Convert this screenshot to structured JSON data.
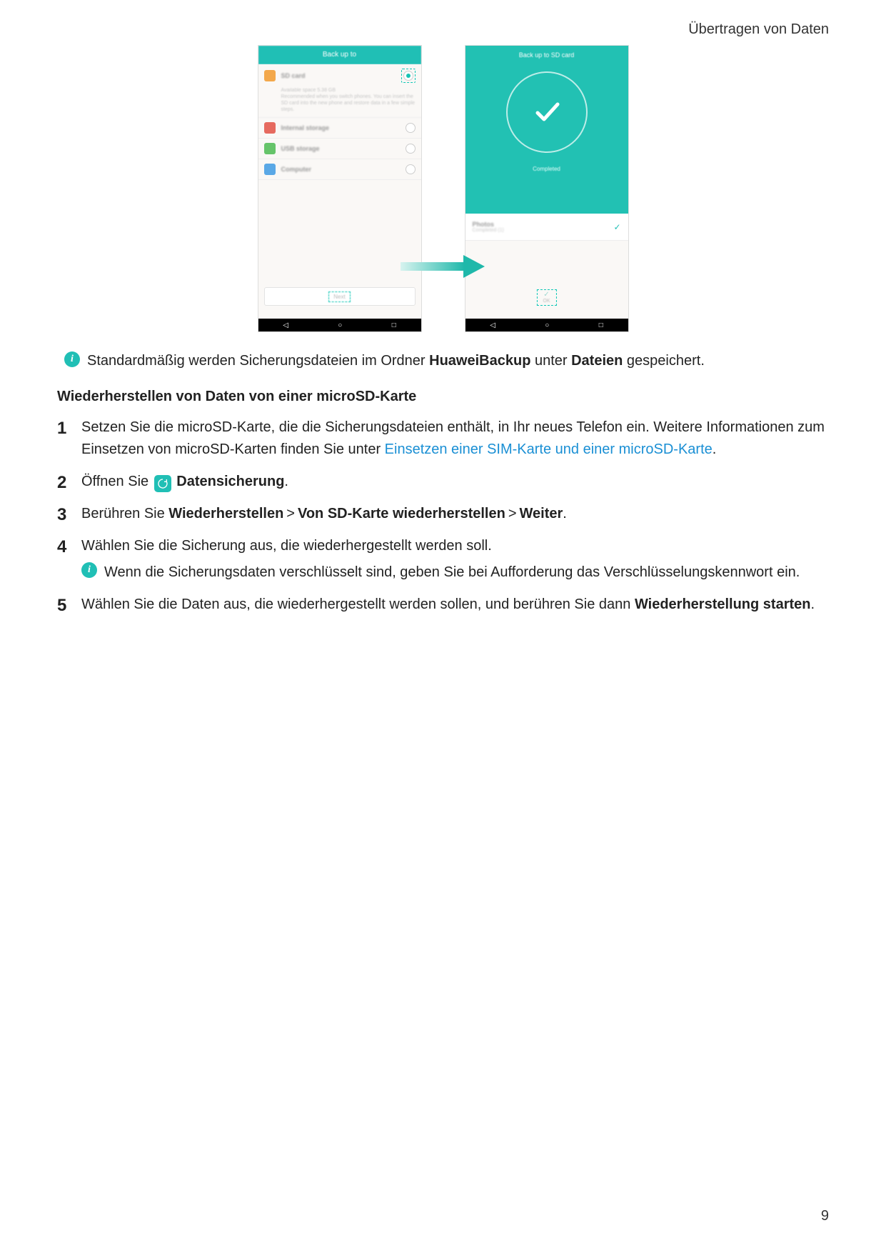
{
  "header": {
    "title": "Übertragen von Daten"
  },
  "page_number": "9",
  "phone1": {
    "title": "Back up to",
    "opt_sd": "SD card",
    "desc1": "Available space 5.38 GB",
    "desc2": "Recommended when you switch phones. You can insert the SD card into the new phone and restore data in a few simple steps.",
    "opt_internal": "Internal storage",
    "opt_usb": "USB storage",
    "opt_computer": "Computer",
    "next": "Next"
  },
  "phone2": {
    "title": "Back up to SD card",
    "completed": "Completed",
    "photos": "Photos",
    "photos_sub": "Completed (1)",
    "ok": "OK"
  },
  "info1": {
    "pre": "Standardmäßig werden Sicherungsdateien im Ordner ",
    "bold1": "HuaweiBackup",
    "mid": " unter ",
    "bold2": "Dateien",
    "post": " gespeichert."
  },
  "section_title": "Wiederherstellen von Daten von einer microSD-Karte",
  "steps": {
    "s1a": "Setzen Sie die microSD-Karte, die die Sicherungsdateien enthält, in Ihr neues Telefon ein. Weitere Informationen zum Einsetzen von microSD-Karten finden Sie unter ",
    "s1link": "Einsetzen einer SIM-Karte und einer microSD-Karte",
    "s1b": ".",
    "s2a": "Öffnen Sie ",
    "s2b": "Datensicherung",
    "s2c": ".",
    "s3a": "Berühren Sie ",
    "s3b": "Wiederherstellen",
    "s3c": "Von SD-Karte wiederherstellen",
    "s3d": "Weiter",
    "s3e": ".",
    "s4a": "Wählen Sie die Sicherung aus, die wiederhergestellt werden soll.",
    "s4info": "Wenn die Sicherungsdaten verschlüsselt sind, geben Sie bei Aufforderung das Verschlüsselungskennwort ein.",
    "s5a": "Wählen Sie die Daten aus, die wiederhergestellt werden sollen, und berühren Sie dann ",
    "s5b": "Wiederherstellung starten",
    "s5c": "."
  }
}
